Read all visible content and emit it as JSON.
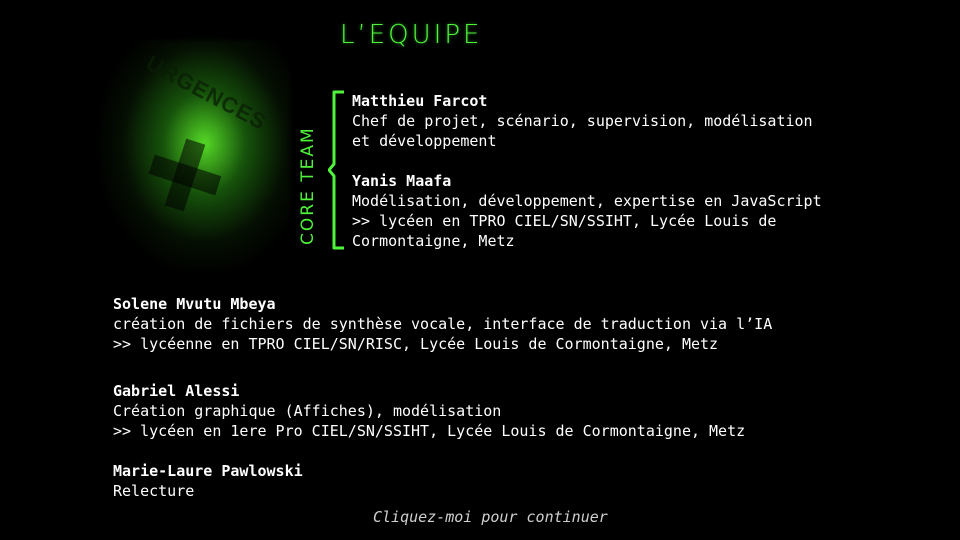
{
  "title": "L’EQUIPE",
  "core_team_label": "CORE TEAM",
  "core_team": [
    {
      "name": "Matthieu Farcot",
      "lines": [
        "Chef de projet, scénario, supervision, modélisation",
        "et développement"
      ]
    },
    {
      "name": "Yanis Maafa",
      "lines": [
        "Modélisation, développement, expertise en JavaScript",
        ">> lycéen en TPRO CIEL/SN/SSIHT, Lycée Louis de",
        "Cormontaigne, Metz"
      ]
    }
  ],
  "other_members": [
    {
      "name": "Solene Mvutu Mbeya",
      "lines": [
        "création de fichiers de synthèse vocale, interface de traduction via l’IA",
        ">> lycéenne en TPRO CIEL/SN/RISC, Lycée Louis de Cormontaigne, Metz"
      ]
    },
    {
      "name": "Gabriel Alessi",
      "lines": [
        "Création graphique (Affiches), modélisation",
        ">> lycéen en 1ere Pro CIEL/SN/SSIHT, Lycée Louis de Cormontaigne, Metz"
      ]
    },
    {
      "name": "Marie-Laure Pawlowski",
      "lines": [
        "Relecture"
      ]
    }
  ],
  "footer": "Cliquez-moi pour continuer",
  "background_sign_text": "URGENCES",
  "colors": {
    "accent": "#4ef33a",
    "background": "#000000",
    "text": "#ffffff"
  }
}
